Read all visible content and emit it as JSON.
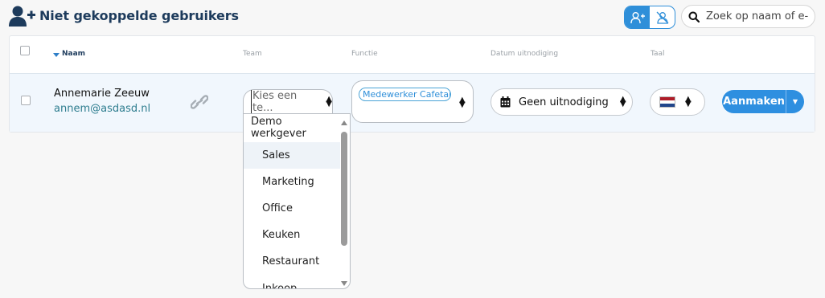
{
  "header": {
    "title": "Niet gekoppelde gebruikers",
    "title_icon": "user-plus-icon",
    "toggle": {
      "active_icon": "user-plus-icon",
      "inactive_icon": "user-slash-icon"
    },
    "search": {
      "placeholder": "Zoek op naam of e-",
      "icon": "search-icon"
    }
  },
  "table": {
    "columns": {
      "name": "Naam",
      "team": "Team",
      "functie": "Functie",
      "datum": "Datum uitnodiging",
      "taal": "Taal"
    },
    "sort_icon": "caret-down-icon",
    "rows": [
      {
        "name": "Annemarie Zeeuw",
        "email": "annem@asdasd.nl",
        "link_icon": "link-icon",
        "team_placeholder": "Kies een te...",
        "functie_tag": "Medewerker Cafetar",
        "datum": "Geen uitnodiging",
        "datum_icon": "calendar-icon",
        "taal_flag": "flag-nl-icon",
        "action": "Aanmaken"
      }
    ]
  },
  "team_dropdown": {
    "group": "Demo werkgever",
    "options": [
      "Sales",
      "Marketing",
      "Office",
      "Keuken",
      "Restaurant",
      "Inkoop"
    ],
    "highlighted": "Sales"
  },
  "colors": {
    "title": "#1d3b5c",
    "accent": "#2e8fe0",
    "email": "#2e7d8f",
    "row_bg": "#f1f7fd",
    "flag": [
      "#ae1c28",
      "#ffffff",
      "#21468b"
    ]
  }
}
